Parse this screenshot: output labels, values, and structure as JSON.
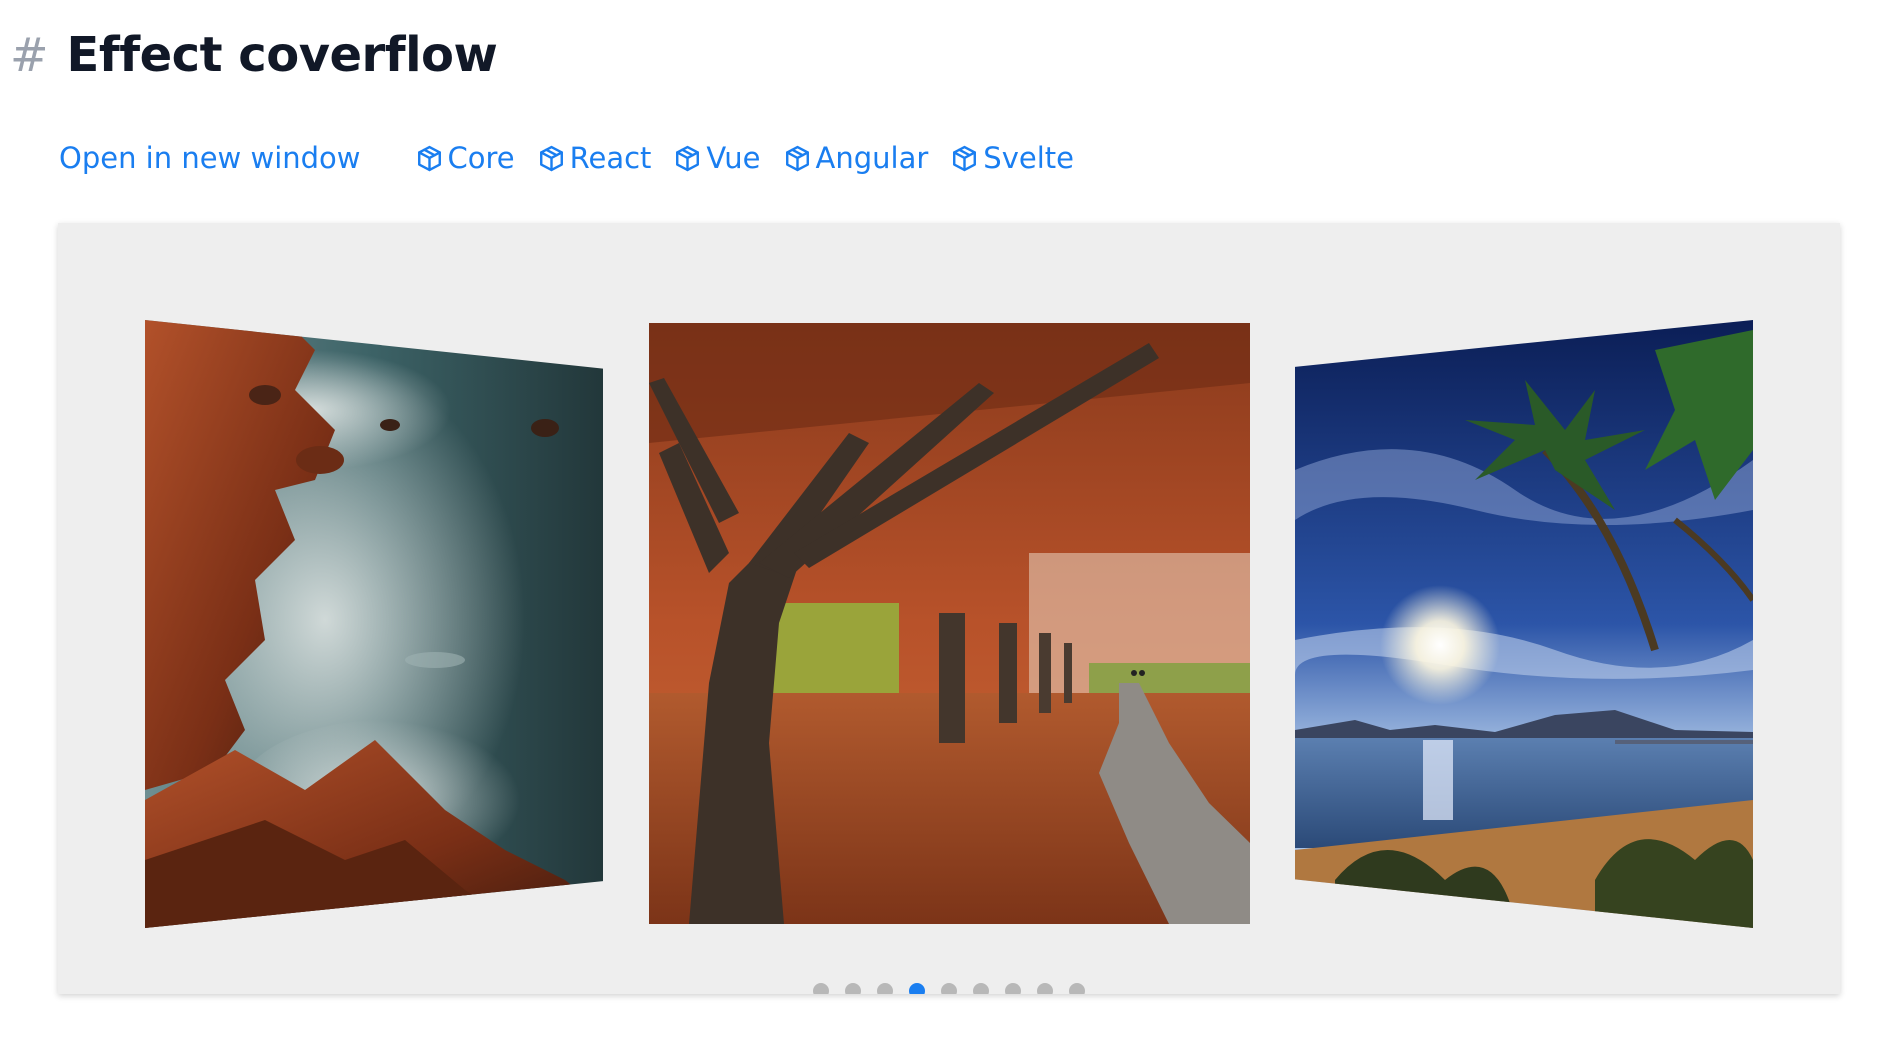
{
  "heading": {
    "hash": "#",
    "title": "Effect coverflow"
  },
  "links": {
    "open_new_window": "Open in new window",
    "frameworks": [
      {
        "label": "Core",
        "icon": "cube-icon"
      },
      {
        "label": "React",
        "icon": "cube-icon"
      },
      {
        "label": "Vue",
        "icon": "cube-icon"
      },
      {
        "label": "Angular",
        "icon": "cube-icon"
      },
      {
        "label": "Svelte",
        "icon": "cube-icon"
      }
    ]
  },
  "carousel": {
    "slides": [
      {
        "name": "coastal-rocks-mist",
        "position": "left"
      },
      {
        "name": "autumn-trees-path",
        "position": "center"
      },
      {
        "name": "tropical-beach-sunset",
        "position": "right"
      }
    ],
    "pagination": {
      "count": 9,
      "active_index": 3
    }
  },
  "colors": {
    "link": "#1a7ef0",
    "title": "#111827",
    "hash": "#9aa1ad",
    "demo_background": "#eeeeee",
    "bullet_inactive": "#b8b8b8",
    "bullet_active": "#1a7ef0"
  }
}
